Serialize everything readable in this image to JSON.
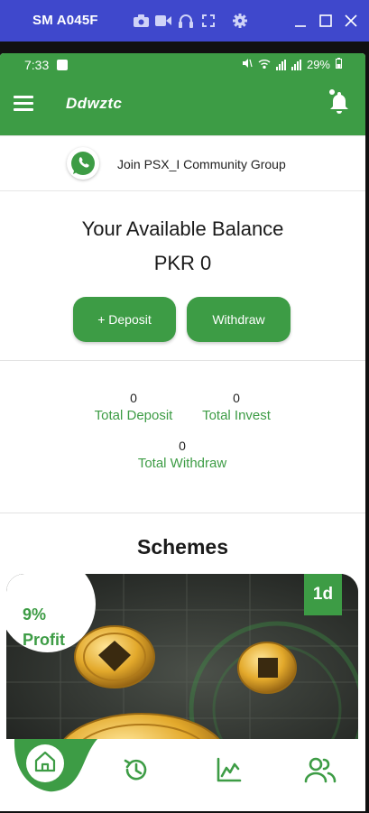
{
  "window": {
    "title": "SM A045F"
  },
  "status_bar": {
    "time": "7:33",
    "battery": "29%"
  },
  "app_bar": {
    "title": "Ddwztc"
  },
  "community": {
    "label": "Join PSX_I Community Group"
  },
  "balance": {
    "title": "Your Available Balance",
    "amount": "PKR 0",
    "deposit_label": "+ Deposit",
    "withdraw_label": "Withdraw"
  },
  "stats": {
    "total_deposit": {
      "value": "0",
      "label": "Total Deposit"
    },
    "total_invest": {
      "value": "0",
      "label": "Total Invest"
    },
    "total_withdraw": {
      "value": "0",
      "label": "Total Withdraw"
    }
  },
  "schemes": {
    "title": "Schemes",
    "card": {
      "profit_pct": "9%",
      "profit_word": "Profit",
      "duration": "1d"
    }
  },
  "bottom_nav": {
    "items": [
      {
        "icon": "home-icon",
        "active": true
      },
      {
        "icon": "history-icon",
        "active": false
      },
      {
        "icon": "chart-icon",
        "active": false
      },
      {
        "icon": "team-icon",
        "active": false
      }
    ]
  },
  "colors": {
    "accent": "#3d9c45",
    "window_bar": "#3f48cc"
  }
}
